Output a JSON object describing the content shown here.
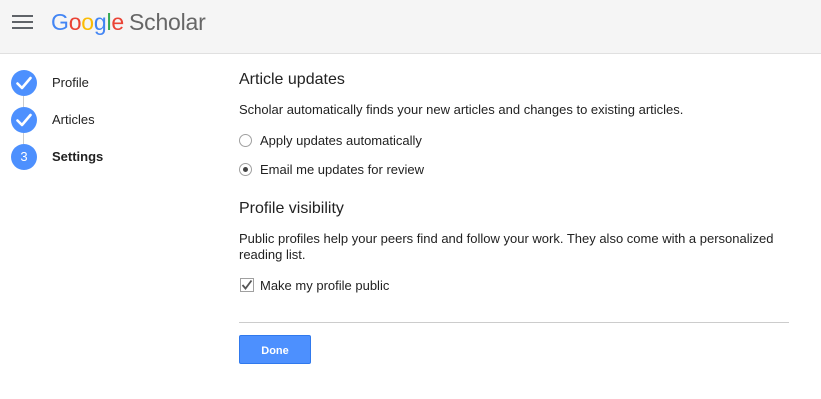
{
  "header": {
    "logo": {
      "letters": [
        "G",
        "o",
        "o",
        "g",
        "l",
        "e"
      ],
      "product": "Scholar"
    }
  },
  "steps": [
    {
      "number": "1",
      "label": "Profile",
      "status": "complete"
    },
    {
      "number": "2",
      "label": "Articles",
      "status": "complete"
    },
    {
      "number": "3",
      "label": "Settings",
      "status": "current"
    }
  ],
  "article_updates": {
    "title": "Article updates",
    "description": "Scholar automatically finds your new articles and changes to existing articles.",
    "options": [
      {
        "label": "Apply updates automatically",
        "selected": false
      },
      {
        "label": "Email me updates for review",
        "selected": true
      }
    ]
  },
  "profile_visibility": {
    "title": "Profile visibility",
    "description": "Public profiles help your peers find and follow your work. They also come with a personalized reading list.",
    "checkbox": {
      "label": "Make my profile public",
      "checked": true
    }
  },
  "actions": {
    "done_label": "Done"
  },
  "colors": {
    "accent": "#4d90fe",
    "header_bg": "#f5f5f5",
    "logo": [
      "#4285f4",
      "#ea4335",
      "#fbbc05",
      "#4285f4",
      "#34a853",
      "#ea4335"
    ]
  }
}
